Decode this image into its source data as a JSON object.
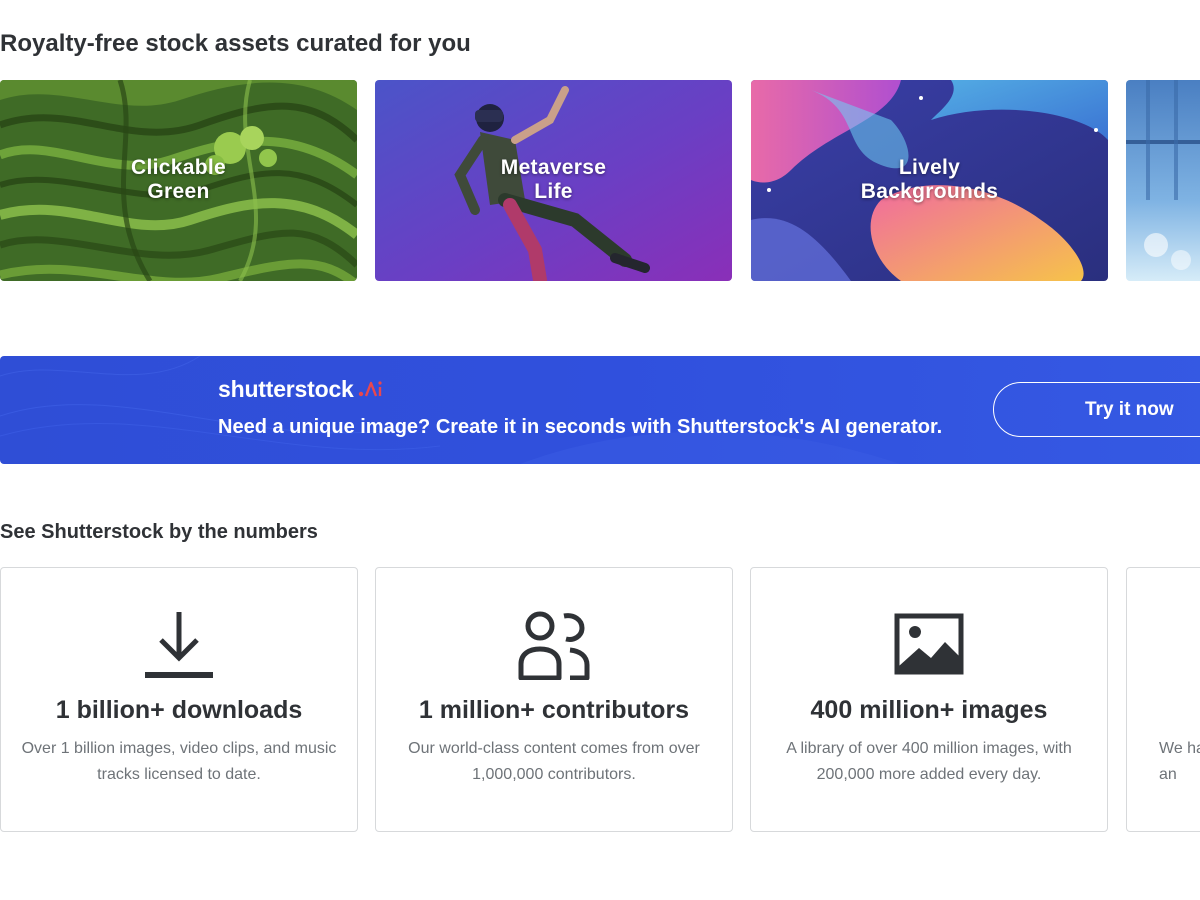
{
  "curated": {
    "title": "Royalty-free stock assets curated for you",
    "cards": [
      {
        "label": "Clickable\nGreen",
        "theme": "green-terraces"
      },
      {
        "label": "Metaverse\nLife",
        "theme": "vr-person-purple"
      },
      {
        "label": "Lively\nBackgrounds",
        "theme": "abstract-fluid"
      },
      {
        "label": "",
        "theme": "blue-water"
      }
    ]
  },
  "ai_banner": {
    "logo_text": "shutterstock",
    "logo_suffix": ".AI",
    "message": "Need a unique image? Create it in seconds with Shutterstock's AI generator.",
    "button_label": "Try it now",
    "colors": {
      "background": "#3050dd",
      "accent": "#e8474f"
    }
  },
  "numbers": {
    "title": "See Shutterstock by the numbers",
    "cards": [
      {
        "icon": "download-icon",
        "headline": "1 billion+ downloads",
        "description": "Over 1 billion images, video clips, and music tracks licensed to date."
      },
      {
        "icon": "contributors-icon",
        "headline": "1 million+ contributors",
        "description": "Our world-class content comes from over 1,000,000 contributors."
      },
      {
        "icon": "image-icon",
        "headline": "400 million+ images",
        "description": "A library of over 400 million images, with 200,000 more added every day."
      },
      {
        "icon": "",
        "headline": "",
        "description": "We ha an"
      }
    ]
  }
}
